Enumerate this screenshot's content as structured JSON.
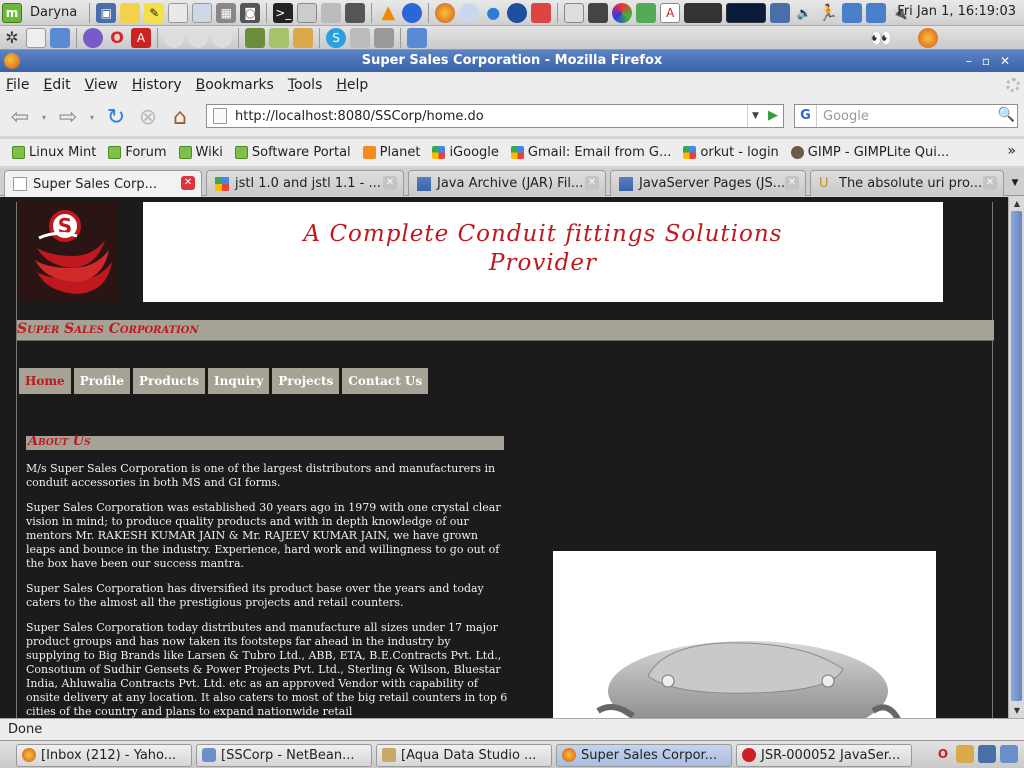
{
  "desktop": {
    "username": "Daryna",
    "clock": "Fri Jan  1, 16:19:03"
  },
  "window": {
    "title": "Super Sales Corporation - Mozilla Firefox"
  },
  "menu": [
    "File",
    "Edit",
    "View",
    "History",
    "Bookmarks",
    "Tools",
    "Help"
  ],
  "navigation": {
    "url": "http://localhost:8080/SSCorp/home.do",
    "search_placeholder": "Google"
  },
  "bookmarks": [
    {
      "label": "Linux Mint",
      "icon": "mint"
    },
    {
      "label": "Forum",
      "icon": "mint"
    },
    {
      "label": "Wiki",
      "icon": "mint"
    },
    {
      "label": "Software Portal",
      "icon": "mint"
    },
    {
      "label": "Planet",
      "icon": "rss"
    },
    {
      "label": "iGoogle",
      "icon": "goog"
    },
    {
      "label": "Gmail: Email from G...",
      "icon": "goog"
    },
    {
      "label": "orkut - login",
      "icon": "goog"
    },
    {
      "label": "GIMP - GIMPLite Qui...",
      "icon": "gimp"
    }
  ],
  "tabs": [
    {
      "label": "Super Sales Corp...",
      "active": true
    },
    {
      "label": "jstl 1.0 and jstl 1.1 - ...",
      "active": false
    },
    {
      "label": "Java Archive (JAR) Fil...",
      "active": false
    },
    {
      "label": "JavaServer Pages (JS...",
      "active": false
    },
    {
      "label": "The absolute uri pro...",
      "active": false
    }
  ],
  "site": {
    "banner": "A Complete Conduit fittings Solutions Provider",
    "company": "Super Sales Corporation",
    "nav": [
      "Home",
      "Profile",
      "Products",
      "Inquiry",
      "Projects",
      "Contact Us"
    ],
    "about_title": "About Us",
    "about_paragraphs": [
      "M/s Super Sales Corporation is one of the largest distributors and manufacturers in conduit accessories in both MS and GI forms.",
      "Super Sales Corporation was established 30 years ago in 1979 with one crystal clear vision in mind; to produce quality products and with in depth knowledge of our mentors Mr. RAKESH KUMAR JAIN & Mr. RAJEEV KUMAR JAIN, we have grown leaps and bounce in the industry. Experience, hard work and willingness to go out of the box have been our success mantra.",
      "Super Sales Corporation has diversified its product base over the years and today caters to the almost all the prestigious projects and retail counters.",
      "Super Sales Corporation today distributes and manufacture all sizes under 17 major product groups and has now taken its footsteps far ahead in the industry by supplying to Big Brands like Larsen & Tubro Ltd., ABB, ETA, B.E.Contracts Pvt. Ltd., Consotium of Sudhir Gensets & Power Projects Pvt. Ltd., Sterling & Wilson, Bluestar India, Ahluwalia Contracts Pvt. Ltd. etc as an approved Vendor with capability of onsite delivery at any location. It also caters to most of the big retail counters in top 6 cities of the country and plans to expand nationwide retail"
    ]
  },
  "status": "Done",
  "taskbar": [
    {
      "label": "[Inbox (212) - Yaho...",
      "color": "#e88a1a"
    },
    {
      "label": "[SSCorp - NetBean...",
      "color": "#6a8fc9"
    },
    {
      "label": "[Aqua Data Studio ...",
      "color": "#c9a96a"
    },
    {
      "label": "Super Sales Corpor...",
      "color": "#e88a1a",
      "active": true
    },
    {
      "label": "JSR-000052 JavaSer...",
      "color": "#cc1f1f"
    }
  ]
}
